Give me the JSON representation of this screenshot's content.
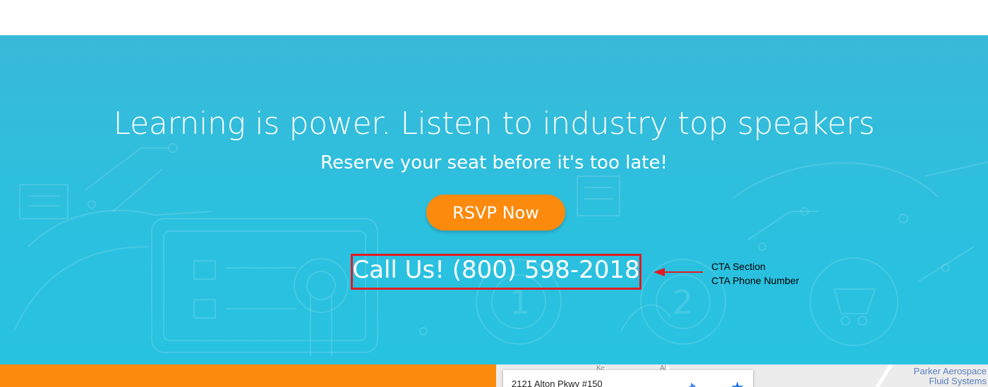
{
  "cta": {
    "headline": "Learning is power. Listen to industry top speakers",
    "subhead": "Reserve your seat before it's too late!",
    "button_label": "RSVP Now",
    "phone_text": "Call Us! (800) 598-2018"
  },
  "annotation": {
    "line1": "CTA Section",
    "line2": "CTA Phone Number",
    "color": "#e21b23"
  },
  "map": {
    "address": "2121 Alton Pkwy #150",
    "poi_line1": "Parker Aerospace",
    "poi_line2": "Fluid Systems",
    "street1": "Ke",
    "street2": "Al",
    "icons": [
      "directions-icon",
      "star-icon"
    ]
  },
  "colors": {
    "cta_background": "#2cc0df",
    "button": "#fb8a0d",
    "highlight_box": "#e21b23",
    "footer_bar": "#fb8a0d"
  }
}
